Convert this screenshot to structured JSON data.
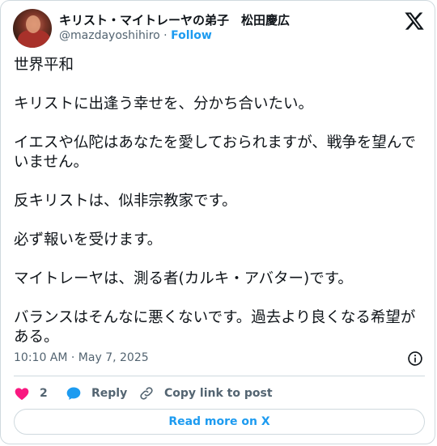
{
  "author": {
    "name": "キリスト・マイトレーヤの弟子　松田慶広",
    "handle": "@mazdayoshihiro",
    "separator": "·",
    "follow_label": "Follow"
  },
  "post": {
    "paragraphs": [
      "世界平和",
      "キリストに出逢う幸せを、分かち合いたい。",
      "イエスや仏陀はあなたを愛しておられますが、戦争を望んでいません。",
      "反キリストは、似非宗教家です。",
      "必ず報いを受けます。",
      "マイトレーヤは、測る者(カルキ・アバター)です。",
      "バランスはそんなに悪くないです。過去より良くなる希望がある。"
    ],
    "timestamp": "10:10 AM · May 7, 2025"
  },
  "actions": {
    "like_count": "2",
    "reply_label": "Reply",
    "copy_link_label": "Copy link to post"
  },
  "footer": {
    "read_more_label": "Read more on X"
  },
  "colors": {
    "accent": "#1d9bf0",
    "like": "#f91880",
    "muted": "#536471",
    "border": "#cfd9de"
  },
  "icons": [
    "x-logo-icon",
    "info-icon",
    "heart-icon",
    "reply-bubble-icon",
    "link-icon"
  ]
}
